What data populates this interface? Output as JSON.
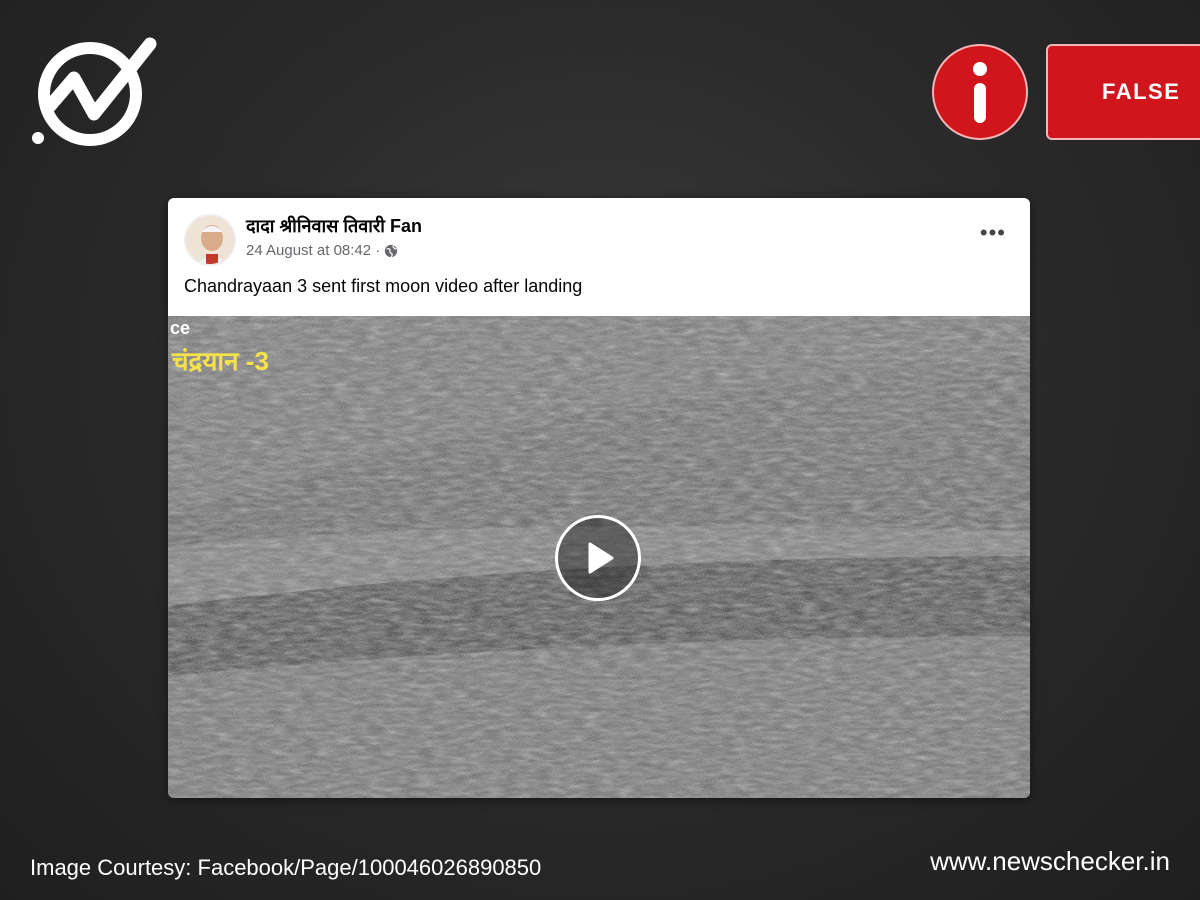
{
  "brand": {
    "logo_icon": "newschecker-checkmark-logo",
    "site": "www.newschecker.in"
  },
  "verdict": {
    "icon": "info-icon",
    "label": "FALSE",
    "color": "#d0151c"
  },
  "post": {
    "author": "दादा श्रीनिवास तिवारी Fan",
    "timestamp": "24 August at 08:42 ·",
    "privacy_icon": "globe-icon",
    "more_label": "•••",
    "caption": "Chandrayaan 3 sent first moon video after landing",
    "video": {
      "overlay_top": "ce",
      "overlay_title": "चंद्रयान -3",
      "overlay_title_color": "#f5e24a",
      "play_icon": "play-icon"
    }
  },
  "footer": {
    "credit": "Image Courtesy: Facebook/Page/100046026890850"
  }
}
